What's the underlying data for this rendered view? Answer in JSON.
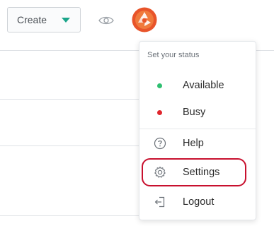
{
  "toolbar": {
    "create_label": "Create"
  },
  "status_menu": {
    "heading": "Set your status",
    "statuses": [
      {
        "label": "Available",
        "color": "#2fbf71"
      },
      {
        "label": "Busy",
        "color": "#e0262d"
      }
    ],
    "actions": [
      {
        "label": "Help",
        "icon": "help-circle-icon"
      },
      {
        "label": "Settings",
        "icon": "gear-icon"
      },
      {
        "label": "Logout",
        "icon": "logout-icon"
      }
    ]
  },
  "colors": {
    "accent": "#1ba58a",
    "highlight": "#c8102e",
    "avatar": "#e8542a"
  }
}
